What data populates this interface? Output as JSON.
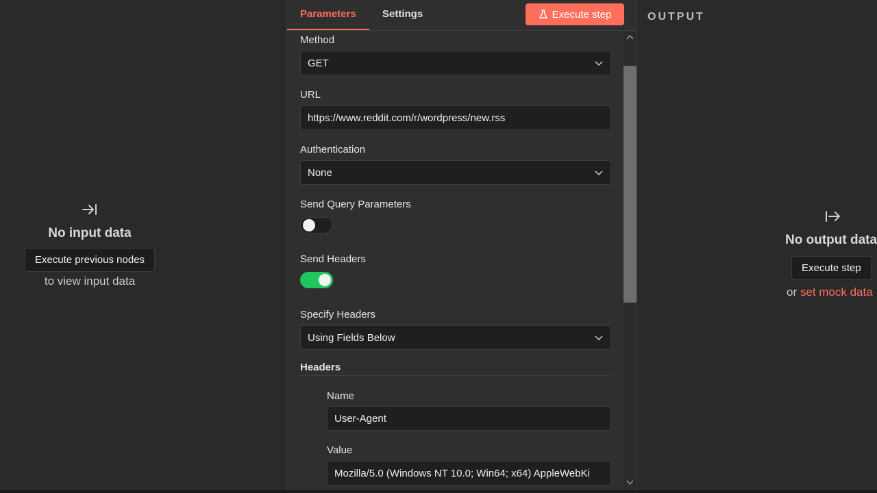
{
  "input_panel": {
    "title": "No input data",
    "button": "Execute previous nodes",
    "subtitle": "to view input data",
    "icon": "arrow-in-icon"
  },
  "tabs": [
    {
      "label": "Parameters",
      "active": true
    },
    {
      "label": "Settings",
      "active": false
    }
  ],
  "execute_step_label": "Execute step",
  "fields": {
    "method_label": "Method",
    "method_value": "GET",
    "url_label": "URL",
    "url_value": "https://www.reddit.com/r/wordpress/new.rss",
    "auth_label": "Authentication",
    "auth_value": "None",
    "send_query_label": "Send Query Parameters",
    "send_query_on": false,
    "send_headers_label": "Send Headers",
    "send_headers_on": true,
    "specify_headers_label": "Specify Headers",
    "specify_headers_value": "Using Fields Below",
    "headers_section": "Headers",
    "name_label": "Name",
    "name_value": "User-Agent",
    "value_label": "Value",
    "value_value": "Mozilla/5.0 (Windows NT 10.0; Win64; x64) AppleWebKi"
  },
  "output_panel": {
    "label": "OUTPUT",
    "title": "No output data",
    "button": "Execute step",
    "sub_prefix": "or",
    "sub_link": "set mock data",
    "icon": "arrow-out-icon"
  },
  "colors": {
    "accent": "#ff6f5c",
    "toggle_on": "#21c55e"
  }
}
